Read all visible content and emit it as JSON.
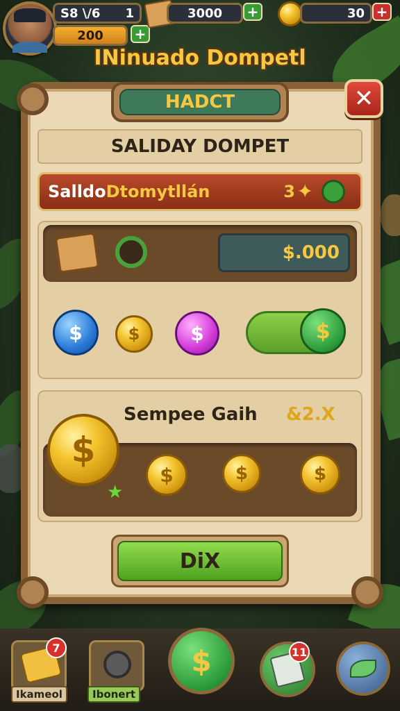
{
  "top_bar": {
    "player_name": "S8 \\/6",
    "level": "1",
    "xp_value": "200",
    "gem_amount": "3000",
    "gold_amount": "30",
    "plus_symbol": "+"
  },
  "screen_title": "INinuado Dompetl",
  "panel": {
    "header_tab": "HADCT",
    "close_symbol": "✕",
    "subtitle": "SALIDAY DOMPET",
    "red_bar": {
      "label_part1": "Salldo ",
      "label_part2": "Dtomytllán",
      "count": "3"
    },
    "balance": "$.000",
    "currency_symbol": "$",
    "gain": {
      "label": "Sempee Gaih",
      "multiplier": "&2.X"
    },
    "action_button": "DiX"
  },
  "bottom_nav": {
    "items": [
      {
        "label": "Ikameol",
        "badge": "7"
      },
      {
        "label": "Ibonert"
      },
      {
        "symbol": "$"
      },
      {
        "badge": "11"
      },
      {}
    ]
  },
  "colors": {
    "panel_parchment": "#ead9b4",
    "panel_border": "#8a6238",
    "accent_gold": "#f5c842",
    "header_green": "#3e7a5a",
    "close_red": "#c83030",
    "action_green": "#6cc232"
  },
  "icons": [
    "avatar-portrait",
    "gem-box-icon",
    "gold-coin-icon",
    "chest-icon",
    "wheel-icon",
    "star-icon",
    "blue-dollar-gem",
    "purple-dollar-gem",
    "toggle-switch",
    "trophy-icon",
    "shop-icon",
    "map-icon"
  ]
}
